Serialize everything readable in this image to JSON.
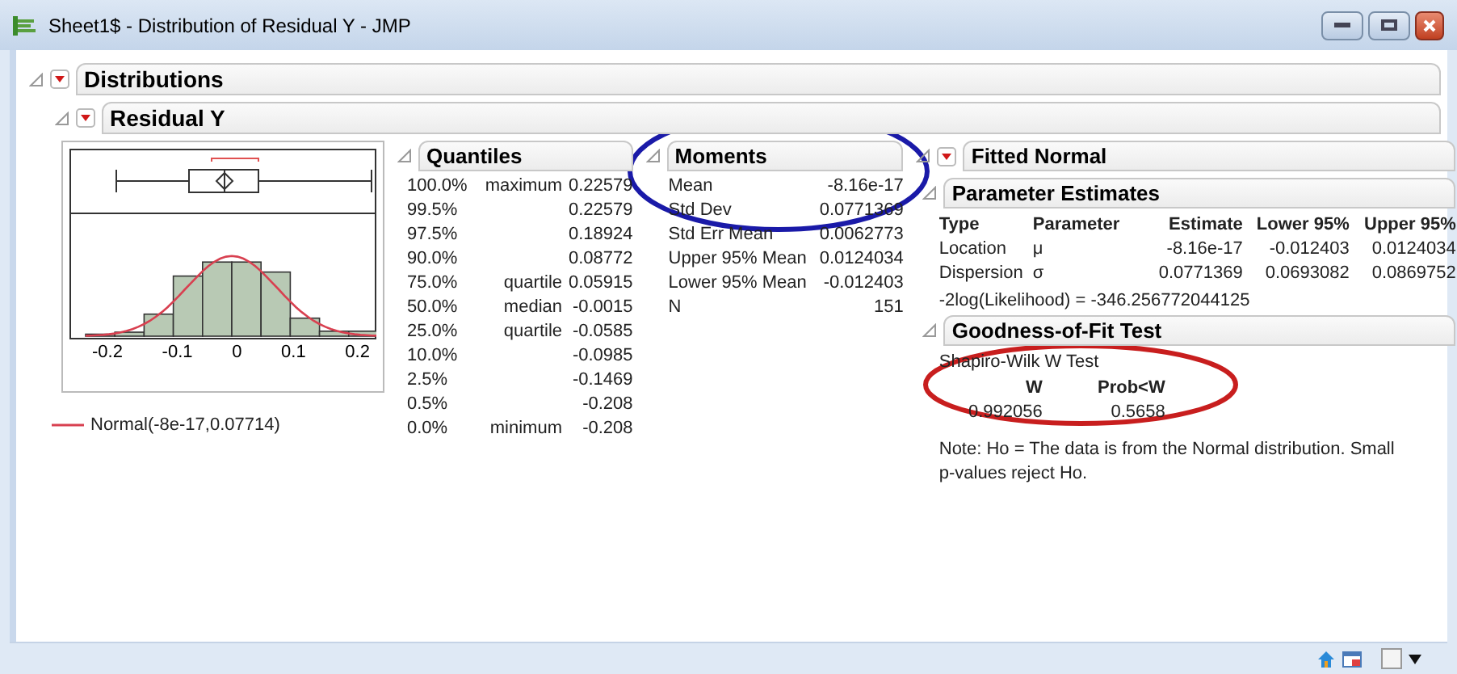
{
  "window": {
    "title": "Sheet1$ - Distribution of Residual Y - JMP"
  },
  "distributions": {
    "title": "Distributions"
  },
  "residual": {
    "title": "Residual Y",
    "histogram": {
      "ticks": [
        "-0.2",
        "-0.1",
        "0",
        "0.1",
        "0.2"
      ],
      "legend": "Normal(-8e-17,0.07714)"
    },
    "quantiles": {
      "title": "Quantiles",
      "rows": [
        {
          "percent": "100.0%",
          "label": "maximum",
          "value": "0.22579"
        },
        {
          "percent": "99.5%",
          "label": "",
          "value": "0.22579"
        },
        {
          "percent": "97.5%",
          "label": "",
          "value": "0.18924"
        },
        {
          "percent": "90.0%",
          "label": "",
          "value": "0.08772"
        },
        {
          "percent": "75.0%",
          "label": "quartile",
          "value": "0.05915"
        },
        {
          "percent": "50.0%",
          "label": "median",
          "value": "-0.0015"
        },
        {
          "percent": "25.0%",
          "label": "quartile",
          "value": "-0.0585"
        },
        {
          "percent": "10.0%",
          "label": "",
          "value": "-0.0985"
        },
        {
          "percent": "2.5%",
          "label": "",
          "value": "-0.1469"
        },
        {
          "percent": "0.5%",
          "label": "",
          "value": "-0.208"
        },
        {
          "percent": "0.0%",
          "label": "minimum",
          "value": "-0.208"
        }
      ]
    },
    "moments": {
      "title": "Moments",
      "rows": [
        {
          "label": "Mean",
          "value": "-8.16e-17"
        },
        {
          "label": "Std Dev",
          "value": "0.0771369"
        },
        {
          "label": "Std Err Mean",
          "value": "0.0062773"
        },
        {
          "label": "Upper 95% Mean",
          "value": "0.0124034"
        },
        {
          "label": "Lower 95% Mean",
          "value": "-0.012403"
        },
        {
          "label": "N",
          "value": "151"
        }
      ]
    },
    "fitted_normal": {
      "title": "Fitted Normal",
      "parameter_estimates": {
        "title": "Parameter Estimates",
        "columns": [
          "Type",
          "Parameter",
          "Estimate",
          "Lower 95%",
          "Upper 95%"
        ],
        "rows": [
          [
            "Location",
            "μ",
            "-8.16e-17",
            "-0.012403",
            "0.0124034"
          ],
          [
            "Dispersion",
            "σ",
            "0.0771369",
            "0.0693082",
            "0.0869752"
          ]
        ],
        "likelihood": "-2log(Likelihood) = -346.256772044125"
      },
      "goodness_of_fit": {
        "title": "Goodness-of-Fit Test",
        "test_name": "Shapiro-Wilk W Test",
        "columns": [
          "W",
          "Prob<W"
        ],
        "values": [
          "0.992056",
          "0.5658"
        ],
        "note": "Note: Ho = The data is from the Normal distribution. Small p-values reject Ho."
      }
    }
  },
  "annotations": [
    {
      "color": "#1a1aa8"
    },
    {
      "color": "#c81e1e"
    }
  ]
}
